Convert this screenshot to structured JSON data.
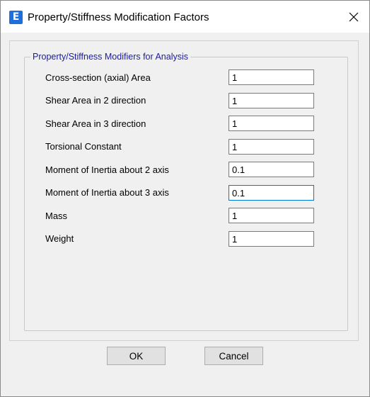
{
  "window": {
    "title": "Property/Stiffness Modification Factors",
    "app_icon_letter": "E",
    "icons": {
      "app": "etabs-app-icon",
      "close": "close-icon"
    }
  },
  "group": {
    "legend": "Property/Stiffness Modifiers for Analysis"
  },
  "fields": [
    {
      "label": "Cross-section (axial) Area",
      "value": "1"
    },
    {
      "label": "Shear Area in 2 direction",
      "value": "1"
    },
    {
      "label": "Shear Area in 3 direction",
      "value": "1"
    },
    {
      "label": "Torsional Constant",
      "value": "1"
    },
    {
      "label": "Moment of Inertia about 2 axis",
      "value": "0.1"
    },
    {
      "label": "Moment of Inertia about 3 axis",
      "value": "0.1"
    },
    {
      "label": "Mass",
      "value": "1"
    },
    {
      "label": "Weight",
      "value": "1"
    }
  ],
  "buttons": {
    "ok": "OK",
    "cancel": "Cancel"
  },
  "colors": {
    "legend_text": "#1a1aa6",
    "focus_border": "#0078d7",
    "app_icon_bg": "#1e6fd9"
  }
}
